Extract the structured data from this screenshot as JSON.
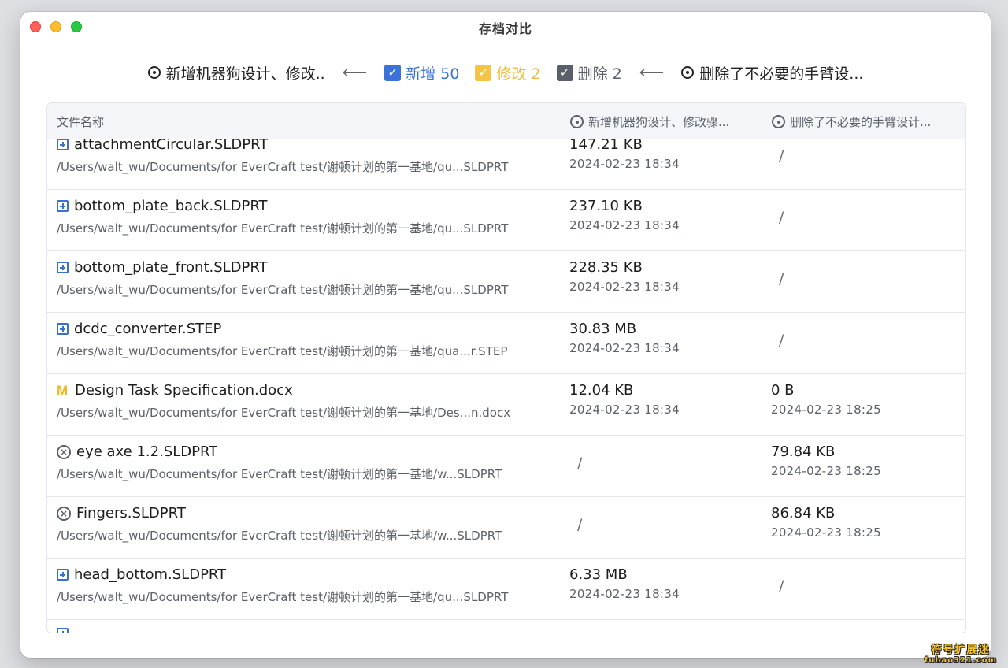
{
  "window": {
    "title": "存档对比"
  },
  "compare": {
    "left_snapshot": "新增机器狗设计、修改..",
    "right_snapshot": "删除了不必要的手臂设...",
    "arrow": "⟵",
    "filters": [
      {
        "label": "新增 50",
        "checked": true,
        "color": "#3b71d8"
      },
      {
        "label": "修改 2",
        "checked": true,
        "color": "#f3c445"
      },
      {
        "label": "删除 2",
        "checked": true,
        "color": "#5a5f69"
      }
    ]
  },
  "table": {
    "headers": {
      "name": "文件名称",
      "col1": "新增机器狗设计、修改骤...",
      "col2": "删除了不必要的手臂设计..."
    },
    "rows": [
      {
        "status_icon": "plus-square-icon",
        "name": "attachmentCircular.SLDPRT",
        "path": "/Users/walt_wu/Documents/for EverCraft test/谢顿计划的第一基地/qu...SLDPRT",
        "c1_size": "147.21 KB",
        "c1_time": "2024-02-23 18:34",
        "c2_size": "/",
        "c2_time": ""
      },
      {
        "status_icon": "plus-square-icon",
        "name": "bottom_plate_back.SLDPRT",
        "path": "/Users/walt_wu/Documents/for EverCraft test/谢顿计划的第一基地/qu...SLDPRT",
        "c1_size": "237.10 KB",
        "c1_time": "2024-02-23 18:34",
        "c2_size": "/",
        "c2_time": ""
      },
      {
        "status_icon": "plus-square-icon",
        "name": "bottom_plate_front.SLDPRT",
        "path": "/Users/walt_wu/Documents/for EverCraft test/谢顿计划的第一基地/qu...SLDPRT",
        "c1_size": "228.35 KB",
        "c1_time": "2024-02-23 18:34",
        "c2_size": "/",
        "c2_time": ""
      },
      {
        "status_icon": "plus-square-icon",
        "name": "dcdc_converter.STEP",
        "path": "/Users/walt_wu/Documents/for EverCraft test/谢顿计划的第一基地/qua...r.STEP",
        "c1_size": "30.83 MB",
        "c1_time": "2024-02-23 18:34",
        "c2_size": "/",
        "c2_time": ""
      },
      {
        "status_icon": "modified-icon",
        "name": "Design Task Specification.docx",
        "path": "/Users/walt_wu/Documents/for EverCraft test/谢顿计划的第一基地/Des...n.docx",
        "c1_size": "12.04 KB",
        "c1_time": "2024-02-23 18:34",
        "c2_size": "0 B",
        "c2_time": "2024-02-23 18:25"
      },
      {
        "status_icon": "x-circle-icon",
        "name": "eye axe 1.2.SLDPRT",
        "path": "/Users/walt_wu/Documents/for EverCraft test/谢顿计划的第一基地/w...SLDPRT",
        "c1_size": "/",
        "c1_time": "",
        "c2_size": "79.84 KB",
        "c2_time": "2024-02-23 18:25"
      },
      {
        "status_icon": "x-circle-icon",
        "name": "Fingers.SLDPRT",
        "path": "/Users/walt_wu/Documents/for EverCraft test/谢顿计划的第一基地/w...SLDPRT",
        "c1_size": "/",
        "c1_time": "",
        "c2_size": "86.84 KB",
        "c2_time": "2024-02-23 18:25"
      },
      {
        "status_icon": "plus-square-icon",
        "name": "head_bottom.SLDPRT",
        "path": "/Users/walt_wu/Documents/for EverCraft test/谢顿计划的第一基地/qu...SLDPRT",
        "c1_size": "6.33 MB",
        "c1_time": "2024-02-23 18:34",
        "c2_size": "/",
        "c2_time": ""
      }
    ]
  },
  "watermark": {
    "line1": "符号扩展迷",
    "line2": "fuhao321.com"
  }
}
